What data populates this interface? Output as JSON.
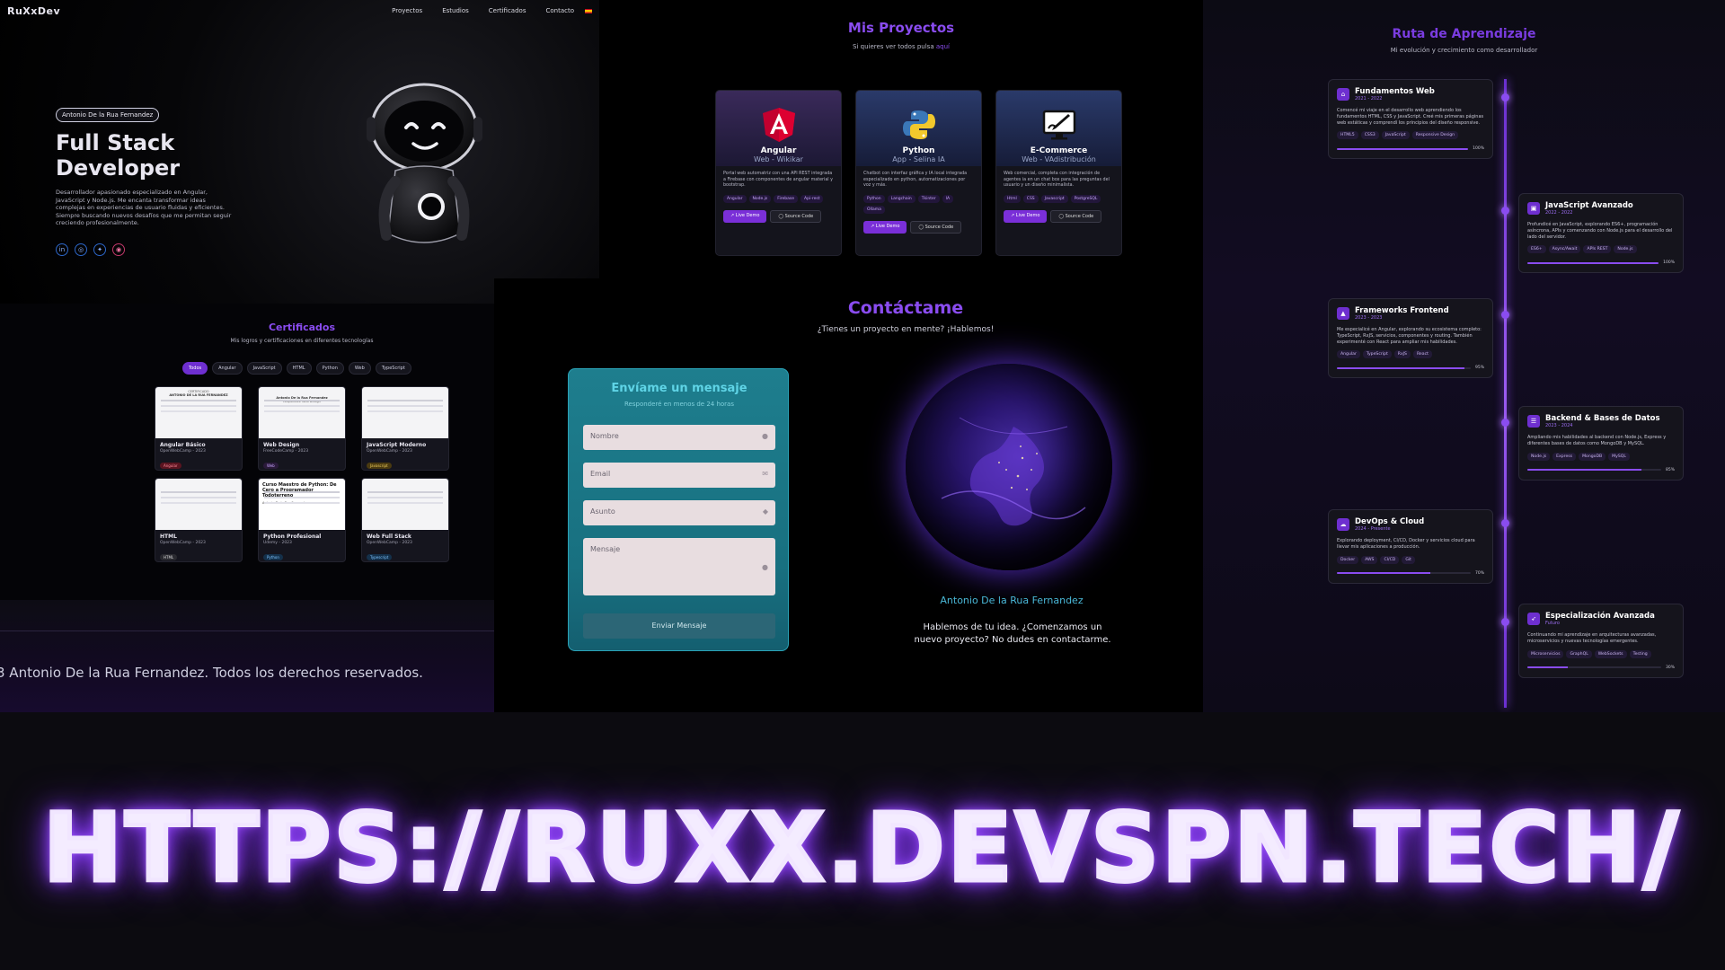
{
  "hero": {
    "brand": "RuXxDev",
    "nav": [
      "Proyectos",
      "Estudios",
      "Certificados",
      "Contacto"
    ],
    "pill": "Antonio De la Rua Fernandez",
    "title": "Full Stack Developer",
    "description": "Desarrollador apasionado especializado en Angular, JavaScript y Node.js. Me encanta transformar ideas complejas en experiencias de usuario fluidas y eficientes. Siempre buscando nuevos desafíos que me permitan seguir creciendo profesionalmente.",
    "socials": [
      "linkedin-icon",
      "github-icon",
      "twitter-icon",
      "instagram-icon"
    ]
  },
  "certs": {
    "title": "Certificados",
    "subtitle": "Mis logros y certificaciones en diferentes tecnologías",
    "filters": [
      "Todos",
      "Angular",
      "JavaScript",
      "HTML",
      "Python",
      "Web",
      "TypeScript"
    ],
    "active_filter": "Todos",
    "items": [
      {
        "title": "Angular Básico",
        "org": "OpenWebCamp - 2023",
        "tag": "Angular"
      },
      {
        "title": "Web Design",
        "org": "FreeCodeCamp - 2023",
        "tag": "Web"
      },
      {
        "title": "JavaScript Moderno",
        "org": "OpenWebCamp - 2023",
        "tag": "Javascript"
      },
      {
        "title": "HTML",
        "org": "OpenWebCamp - 2023",
        "tag": "HTML"
      },
      {
        "title": "Python Profesional",
        "org": "Udemy - 2023",
        "tag": "Python"
      },
      {
        "title": "Web Full Stack",
        "org": "OpenWebCamp - 2023",
        "tag": "Typescript"
      }
    ],
    "cert_preview_text": [
      "CERTIFICADO",
      "ANTONIO DE LA RUA FERNANDEZ",
      "Antonio De la Rua Fernandez",
      "Responsive Web Design",
      "Curso Maestro de Python: De Cero a Programador Todoterreno",
      "Antonio De la Rua Fernandez"
    ]
  },
  "footer": {
    "text": "3 Antonio De la Rua Fernandez. Todos los derechos reservados."
  },
  "projects": {
    "title": "Mis Proyectos",
    "subtitle_prefix": "Si quieres ver todos pulsa",
    "subtitle_link": "aquí",
    "items": [
      {
        "name": "Angular",
        "sub": "Web - Wikikar",
        "icon": "angular-icon",
        "desc": "Portal web automatriz con una API REST integrada a Firebase con componentes de angular material y bootstrap.",
        "tags": [
          "Angular",
          "Node.js",
          "Firebase",
          "Api-rest"
        ]
      },
      {
        "name": "Python",
        "sub": "App - Selina IA",
        "icon": "python-icon",
        "desc": "Chatbot con interfaz gráfica y IA local integrada especializado en python, automatizaciones por voz y más.",
        "tags": [
          "Python",
          "Langchain",
          "Tkinter",
          "IA",
          "Ollama"
        ]
      },
      {
        "name": "E-Commerce",
        "sub": "Web - VAdistribución",
        "icon": "design-monitor-icon",
        "desc": "Web comercial, completa con integración de agentes ia en un chat box para las preguntas del usuario y un diseño minimalista.",
        "tags": [
          "Html",
          "CSS",
          "Javascript",
          "PostgreSQL"
        ]
      }
    ],
    "demo_label": "Live Demo",
    "source_label": "Source Code"
  },
  "contact": {
    "title": "Contáctame",
    "subtitle": "¿Tienes un proyecto en mente? ¡Hablemos!",
    "form_title": "Envíame un mensaje",
    "form_sub": "Responderé en menos de 24 horas",
    "fields": {
      "name": "Nombre",
      "email": "Email",
      "subject": "Asunto",
      "message": "Mensaje"
    },
    "send_label": "Enviar Mensaje",
    "person": "Antonio De la Rua Fernandez",
    "tagline": "Hablemos de tu idea. ¿Comenzamos un nuevo proyecto? No dudes en contactarme."
  },
  "route": {
    "title": "Ruta de Aprendizaje",
    "subtitle": "Mi evolución y crecimiento como desarrollador",
    "stages": [
      {
        "title": "Fundamentos Web",
        "date": "2021 - 2022",
        "icon": "html-icon",
        "desc": "Comencé mi viaje en el desarrollo web aprendiendo los fundamentos HTML, CSS y JavaScript. Creé mis primeras páginas web estáticas y comprendí los principios del diseño responsive.",
        "tags": [
          "HTML5",
          "CSS3",
          "JavaScript",
          "Responsive Design"
        ],
        "progress": 100,
        "pct": "100%"
      },
      {
        "title": "JavaScript Avanzado",
        "date": "2022 - 2022",
        "icon": "js-icon",
        "desc": "Profundicé en JavaScript, explorando ES6+, programación asíncrona, APIs y comenzando con Node.js para el desarrollo del lado del servidor.",
        "tags": [
          "ES6+",
          "Async/Await",
          "APIs REST",
          "Node.js"
        ],
        "progress": 100,
        "pct": "100%"
      },
      {
        "title": "Frameworks Frontend",
        "date": "2023 - 2023",
        "icon": "angular-icon",
        "desc": "Me especialicé en Angular, explorando su ecosistema completo: TypeScript, RxJS, servicios, componentes y routing. También experimenté con React para ampliar mis habilidades.",
        "tags": [
          "Angular",
          "TypeScript",
          "RxJS",
          "React"
        ],
        "progress": 95,
        "pct": "95%"
      },
      {
        "title": "Backend & Bases de Datos",
        "date": "2023 - 2024",
        "icon": "database-icon",
        "desc": "Ampliando mis habilidades al backend con Node.js, Express y diferentes bases de datos como MongoDB y MySQL.",
        "tags": [
          "Node.js",
          "Express",
          "MongoDB",
          "MySQL"
        ],
        "progress": 85,
        "pct": "85%"
      },
      {
        "title": "DevOps & Cloud",
        "date": "2024 - Presente",
        "icon": "cloud-icon",
        "desc": "Explorando deployment, CI/CD, Docker y servicios cloud para llevar mis aplicaciones a producción.",
        "tags": [
          "Docker",
          "AWS",
          "CI/CD",
          "Git"
        ],
        "progress": 70,
        "pct": "70%"
      },
      {
        "title": "Especialización Avanzada",
        "date": "Futuro",
        "icon": "rocket-icon",
        "desc": "Continuando mi aprendizaje en arquitecturas avanzadas, microservicios y nuevas tecnologías emergentes.",
        "tags": [
          "Microservicios",
          "GraphQL",
          "WebSockets",
          "Testing"
        ],
        "progress": 30,
        "pct": "30%"
      }
    ]
  },
  "url": "HTTPS://RUXX.DEVSPN.TECH/",
  "colors": {
    "accent": "#8a4cf0",
    "form_teal": "#1e7e8e",
    "glow": "#9a4cff"
  }
}
